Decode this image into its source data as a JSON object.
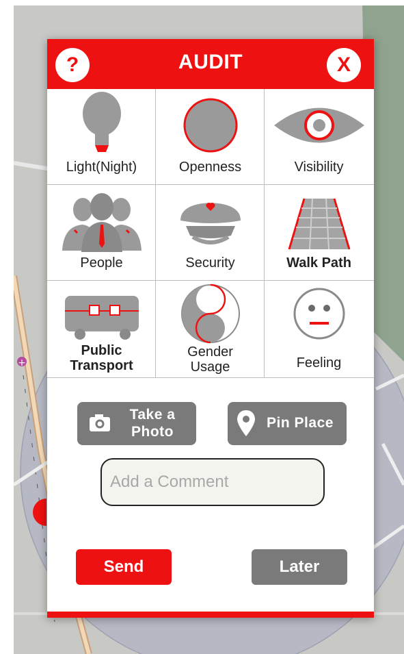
{
  "dialog": {
    "title": "AUDIT",
    "help_icon": "?",
    "close_icon": "X"
  },
  "categories": [
    {
      "label": "Light(Night)",
      "icon": "lightbulb-icon"
    },
    {
      "label": "Openness",
      "icon": "circle-icon"
    },
    {
      "label": "Visibility",
      "icon": "eye-icon"
    },
    {
      "label": "People",
      "icon": "people-icon"
    },
    {
      "label": "Security",
      "icon": "guard-cap-icon"
    },
    {
      "label": "Walk Path",
      "icon": "walk-path-icon"
    },
    {
      "label_line1": "Public",
      "label_line2": "Transport",
      "icon": "bus-icon"
    },
    {
      "label_line1": "Gender",
      "label_line2": "Usage",
      "icon": "gender-symbol-icon"
    },
    {
      "label": "Feeling",
      "icon": "face-icon"
    }
  ],
  "actions": {
    "photo_line1": "Take a",
    "photo_line2": "Photo",
    "photo_icon": "camera-icon",
    "pin_label": "Pin Place",
    "pin_icon": "location-pin-icon"
  },
  "comment": {
    "placeholder": "Add a Comment"
  },
  "buttons": {
    "send": "Send",
    "later": "Later"
  },
  "colors": {
    "accent": "#ee1111",
    "icon_gray": "#9a9a9a",
    "button_gray": "#7a7a7a"
  }
}
